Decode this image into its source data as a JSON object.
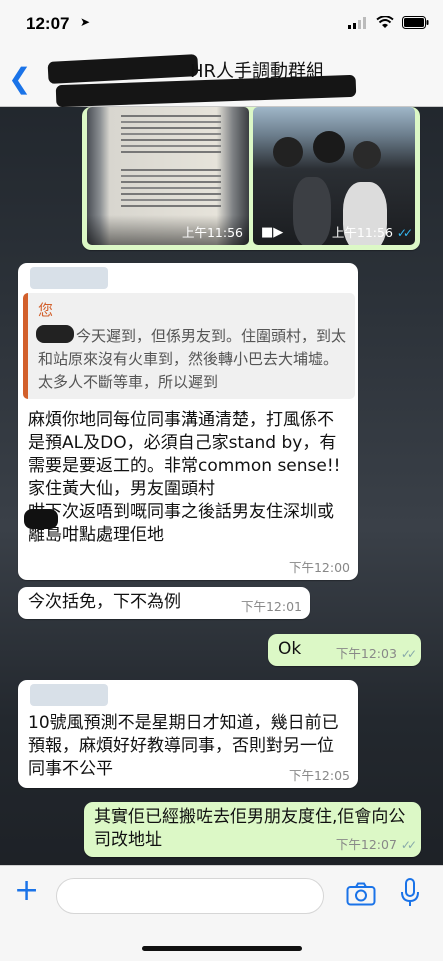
{
  "status_bar": {
    "time": "12:07"
  },
  "header": {
    "title": "HR人手調動群組"
  },
  "messages": {
    "images": {
      "time_left": "上午11:56",
      "time_right": "上午11:56"
    },
    "reply": {
      "quote_sender": "您",
      "quote_text": "今天遲到，但係男友到。住圍頭村，到太和站原來沒有火車到，然後轉小巴去大埔墟。太多人不斷等車，所以遲到",
      "text": "麻煩你地同每位同事溝通清楚，打風係不是預AL及DO，必須自己家stand by，有需要是要返工的。非常common sense!!\n家住黃大仙，男友圍頭村\n咁下次返唔到嘅同事之後話男友住深圳或離島咁點處理佢地",
      "time": "下午12:00"
    },
    "excuse": {
      "text": "今次括免，下不為例",
      "time": "下午12:01"
    },
    "ok": {
      "text": "Ok",
      "time": "下午12:03"
    },
    "typhoon": {
      "text": "10號風預測不是星期日才知道，幾日前已預報，麻煩好好教導同事，否則對另一位同事不公平",
      "time": "下午12:05"
    },
    "reply_out": {
      "text": "其實佢已經搬咗去佢男朋友度住,佢會向公司改地址",
      "time": "下午12:07"
    }
  },
  "icons": [
    "back-icon",
    "plus-icon",
    "camera-icon",
    "microphone-icon",
    "video-icon",
    "read-ticks-icon",
    "wifi-icon",
    "battery-icon",
    "signal-icon"
  ],
  "colors": {
    "outgoing_bubble": "#dcf8c6",
    "incoming_bubble": "#ffffff",
    "quote_accent": "#d25f2b",
    "ios_blue": "#1a73e8"
  }
}
